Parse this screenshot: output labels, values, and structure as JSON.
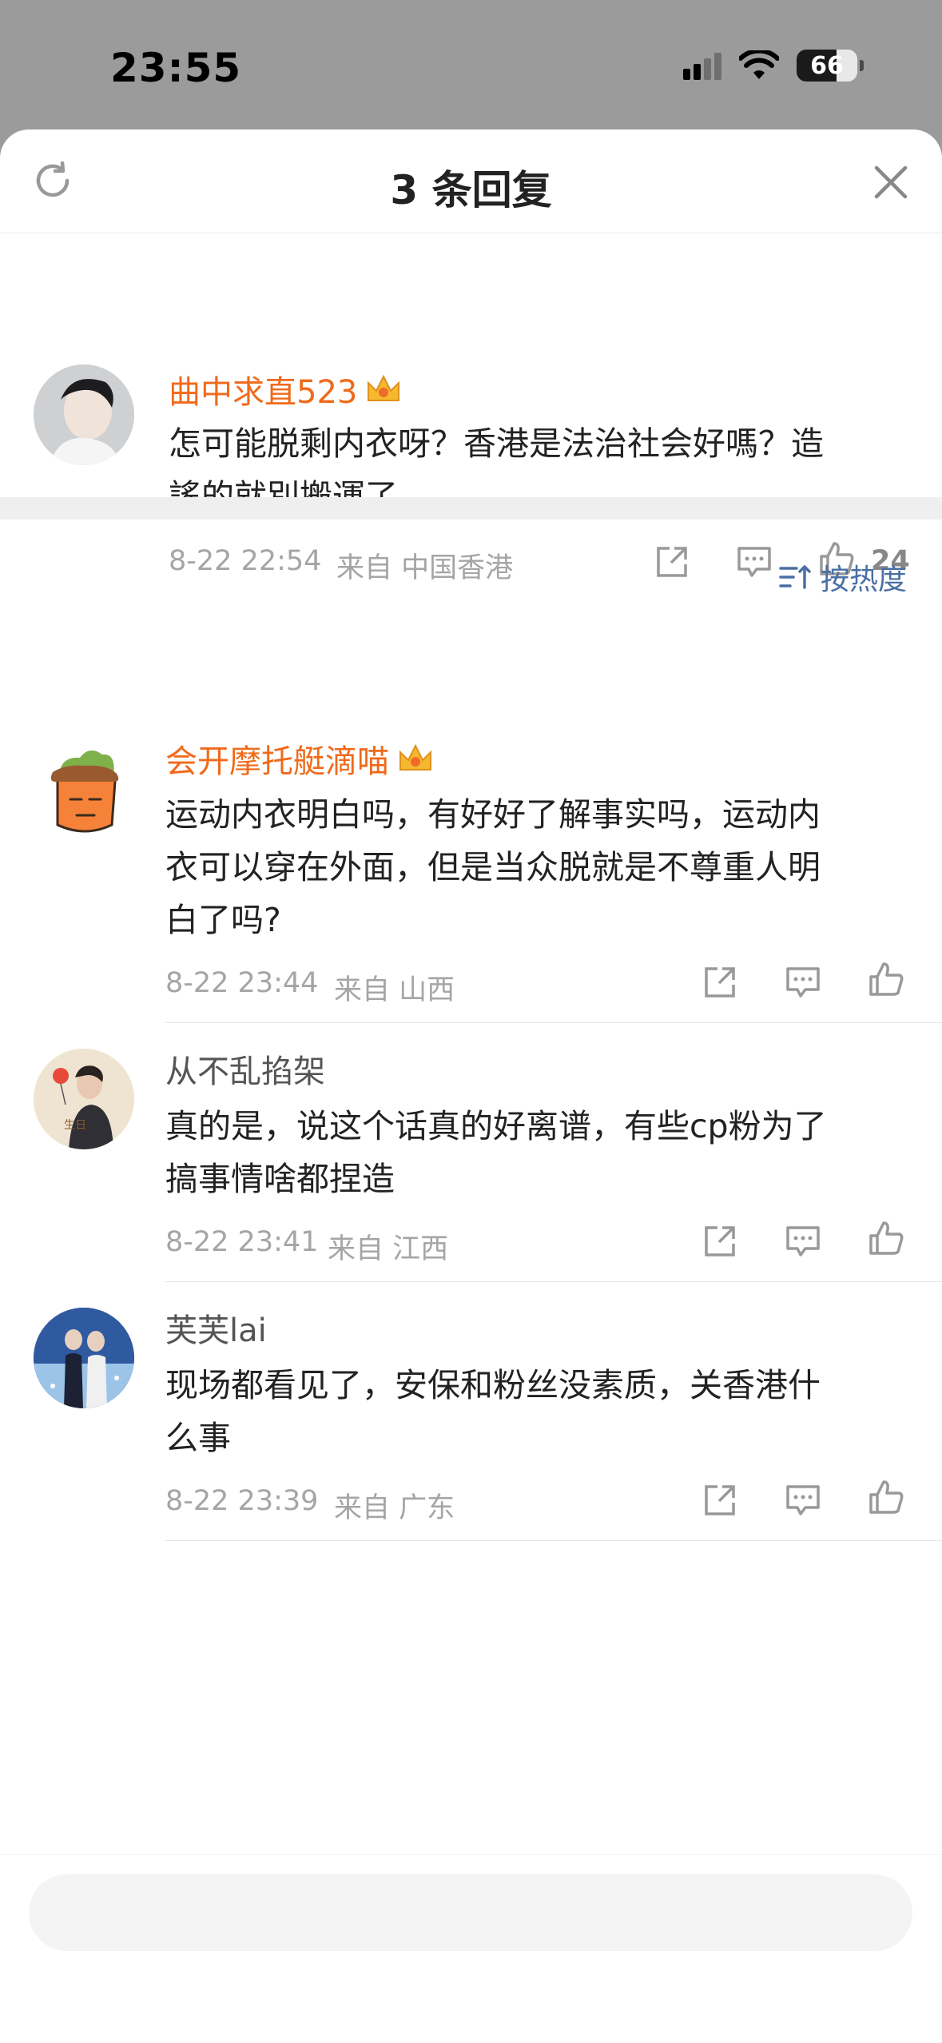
{
  "status_bar": {
    "time": "23:55",
    "battery": "66"
  },
  "header": {
    "title": "3 条回复"
  },
  "root_comment": {
    "author": "曲中求直523",
    "text_line1": "怎可能脱剩内衣呀？香港是法治社会好嗎？造",
    "text_line2": "謠的就別搬運了",
    "time": "8-22 22:54",
    "from": "来自 中国香港",
    "likes": "24"
  },
  "sort": {
    "label": "按热度"
  },
  "replies": [
    {
      "author": "会开摩托艇滴喵",
      "text_line1": "运动内衣明白吗，有好好了解事实吗，运动内",
      "text_line2": "衣可以穿在外面，但是当众脱就是不尊重人明",
      "text_line3": "白了吗?",
      "time": "8-22 23:44",
      "from": "来自 山西"
    },
    {
      "author": "从不乱掐架",
      "text_line1": "真的是，说这个话真的好离谱，有些cp粉为了",
      "text_line2": "搞事情啥都捏造",
      "time": "8-22 23:41",
      "from": "来自 江西"
    },
    {
      "author": "芙芙lai",
      "text_line1": "现场都看见了，安保和粉丝没素质，关香港什",
      "text_line2": "么事",
      "time": "8-22 23:39",
      "from": "来自 广东"
    }
  ],
  "colors": {
    "vip_author": "#f06a1a",
    "sort_link": "#4a6fa5",
    "meta_gray": "#a5a5a5"
  },
  "icons": [
    "refresh-icon",
    "close-icon",
    "share-icon",
    "comment-icon",
    "like-icon",
    "crown-icon",
    "sort-icon",
    "signal-icon",
    "wifi-icon",
    "battery-icon"
  ]
}
